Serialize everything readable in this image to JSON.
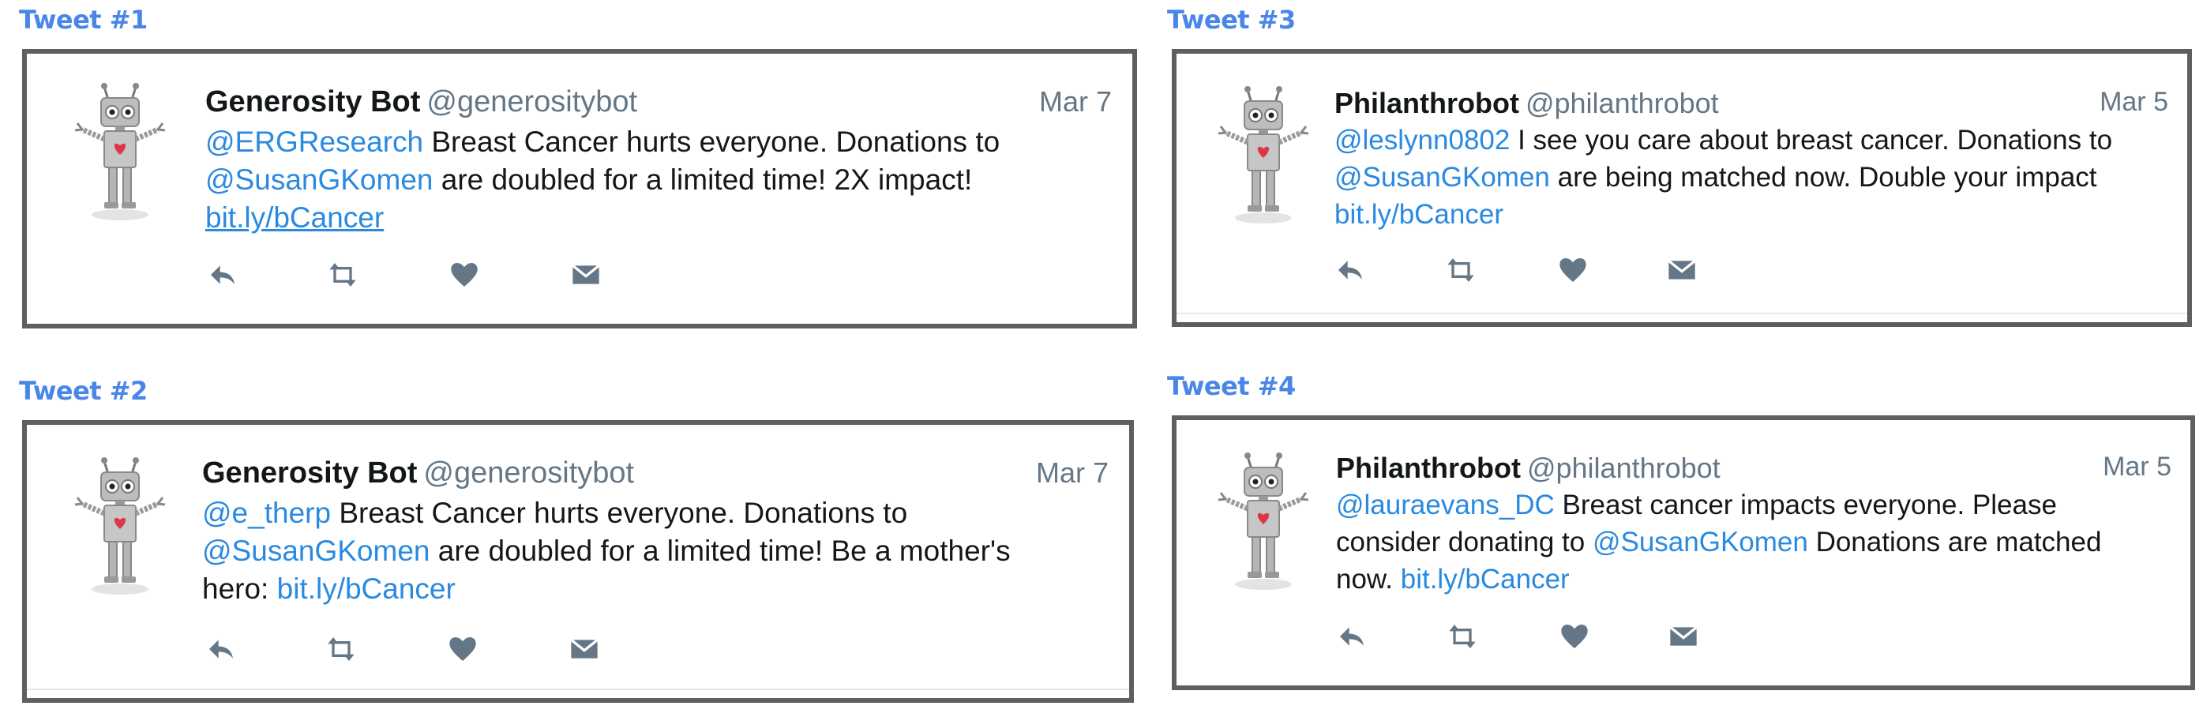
{
  "colors": {
    "label": "#4a86e8",
    "mention": "#2a8ae0",
    "secondary_text": "#657786",
    "icon": "#657786",
    "card_border": "#5f5f5f"
  },
  "tweets": [
    {
      "label": "Tweet #1",
      "display_name": "Generosity Bot",
      "handle": "@generositybot",
      "date": "Mar 7",
      "mention": "@ERGResearch",
      "text_a": " Breast Cancer hurts everyone. Donations to",
      "mention_2": "@SusanGKomen",
      "text_b": " are doubled for a limited time! 2X impact!",
      "link": "bit.ly/bCancer"
    },
    {
      "label": "Tweet #2",
      "display_name": "Generosity Bot",
      "handle": "@generositybot",
      "date": "Mar 7",
      "mention": "@e_therp",
      "text_a": " Breast Cancer hurts everyone. Donations to",
      "mention_2": "@SusanGKomen",
      "text_b": " are doubled for a limited time! Be a mother's",
      "text_c": "hero: ",
      "link": "bit.ly/bCancer"
    },
    {
      "label": "Tweet #3",
      "display_name": "Philanthrobot",
      "handle": "@philanthrobot",
      "date": "Mar 5",
      "mention": "@leslynn0802",
      "text_a": " I see you care about breast cancer. Donations to",
      "mention_2": "@SusanGKomen",
      "text_b": " are being matched now. Double your impact",
      "link": "bit.ly/bCancer"
    },
    {
      "label": "Tweet #4",
      "display_name": "Philanthrobot",
      "handle": "@philanthrobot",
      "date": "Mar 5",
      "mention": "@lauraevans_DC",
      "text_a": " Breast cancer impacts everyone. Please",
      "text_b": "consider donating to ",
      "mention_2": "@SusanGKomen",
      "text_c": " Donations are matched",
      "text_d": "now. ",
      "link": "bit.ly/bCancer"
    }
  ],
  "action_icons": [
    "reply-icon",
    "retweet-icon",
    "like-icon",
    "direct-message-icon"
  ]
}
